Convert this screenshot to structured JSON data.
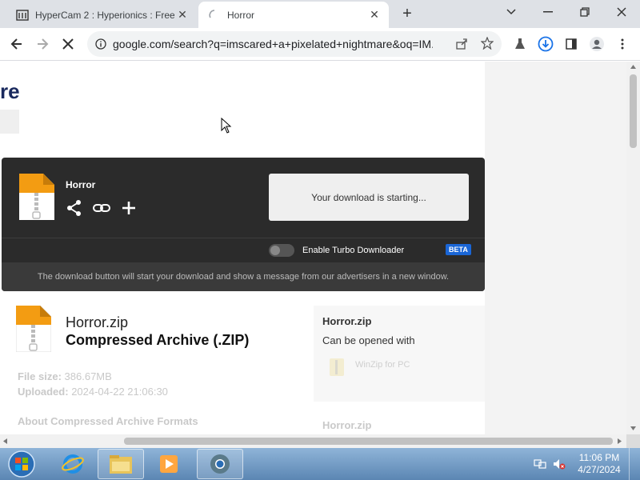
{
  "tabs": [
    {
      "title": "HyperCam 2 : Hyperionics : Free",
      "active": false
    },
    {
      "title": "Horror",
      "active": true
    }
  ],
  "address": {
    "url": "google.com/search?q=imscared+a+pixelated+nightmare&oq=IM..."
  },
  "page": {
    "logo_fragment": "re",
    "download_card": {
      "file_name": "Horror",
      "status": "Your download is starting...",
      "turbo_label": "Enable Turbo Downloader",
      "beta_badge": "BETA",
      "footer_note": "The download button will start your download and show a message from our advertisers in a new window."
    },
    "file_info": {
      "name": "Horror.zip",
      "type": "Compressed Archive (.ZIP)",
      "size_label": "File size:",
      "size_value": "386.67MB",
      "uploaded_label": "Uploaded:",
      "uploaded_value": "2024-04-22 21:06:30",
      "about_heading": "About Compressed Archive Formats"
    },
    "side_box": {
      "name": "Horror.zip",
      "open_with": "Can be opened with",
      "app": "WinZip for PC",
      "name2": "Horror.zip"
    }
  },
  "taskbar": {
    "time": "11:06 PM",
    "date": "4/27/2024"
  },
  "colors": {
    "card_bg": "#2b2b2b",
    "beta_bg": "#1a66d6",
    "zip_orange": "#f39c12"
  }
}
